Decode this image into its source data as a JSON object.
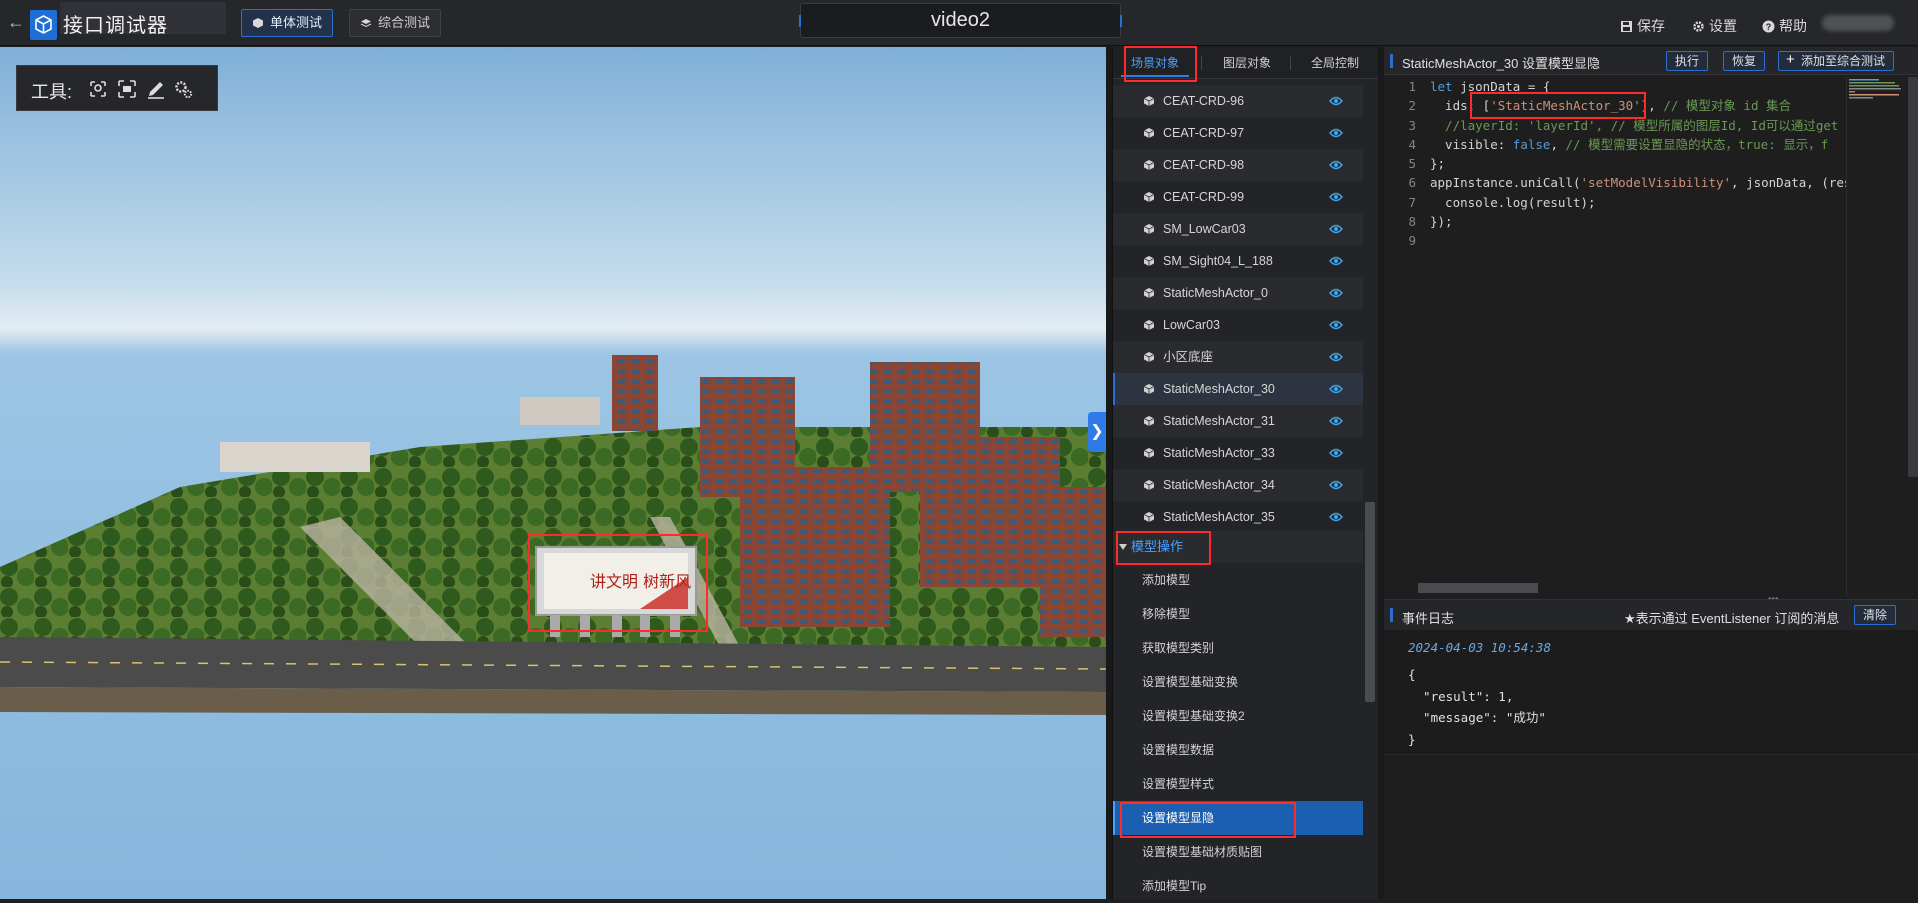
{
  "app": {
    "title": "接口调试器",
    "video_title": "video2"
  },
  "tabs": {
    "single": "单体测试",
    "combined": "综合测试"
  },
  "top_actions": {
    "save": "保存",
    "settings": "设置",
    "help": "帮助"
  },
  "tools": {
    "label": "工具:",
    "icons": [
      "location-pick-icon",
      "frame-select-icon",
      "draw-pen-icon",
      "settings-gears-icon"
    ]
  },
  "mid_tabs": [
    "场景对象",
    "图层对象",
    "全局控制"
  ],
  "objects": [
    "CEAT-CRD-96",
    "CEAT-CRD-97",
    "CEAT-CRD-98",
    "CEAT-CRD-99",
    "SM_LowCar03",
    "SM_Sight04_L_188",
    "StaticMeshActor_0",
    "LowCar03",
    "小区底座",
    "StaticMeshActor_30",
    "StaticMeshActor_31",
    "StaticMeshActor_33",
    "StaticMeshActor_34",
    "StaticMeshActor_35"
  ],
  "group": {
    "label": "模型操作",
    "items": [
      "添加模型",
      "移除模型",
      "获取模型类别",
      "设置模型基础变换",
      "设置模型基础变换2",
      "设置模型数据",
      "设置模型样式",
      "设置模型显隐",
      "设置模型基础材质贴图",
      "添加模型Tip"
    ]
  },
  "code": {
    "title": "StaticMeshActor_30 设置模型显隐",
    "buttons": {
      "run": "执行",
      "restore": "恢复",
      "add": "添加至综合测试"
    },
    "lines": [
      [
        [
          "kw",
          "let "
        ],
        [
          "txt",
          "jsonData = {"
        ]
      ],
      [
        [
          "txt",
          "  ids: ["
        ],
        [
          "str",
          "'StaticMeshActor_30'"
        ],
        [
          "txt",
          "], "
        ],
        [
          "cm",
          "// 模型对象 id 集合"
        ]
      ],
      [
        [
          "cm",
          "  //layerId: 'layerId', // 模型所属的图层Id, Id可以通过get"
        ]
      ],
      [
        [
          "txt",
          "  visible: "
        ],
        [
          "kw",
          "false"
        ],
        [
          "txt",
          ", "
        ],
        [
          "cm",
          "// 模型需要设置显隐的状态，true: 显示，f"
        ]
      ],
      [
        [
          "txt",
          "};"
        ]
      ],
      [
        [
          "txt",
          "appInstance.uniCall("
        ],
        [
          "str",
          "'setModelVisibility'"
        ],
        [
          "txt",
          ", jsonData, (res"
        ]
      ],
      [
        [
          "txt",
          "  console.log(result);"
        ]
      ],
      [
        [
          "txt",
          "});"
        ]
      ],
      [
        [
          "txt",
          ""
        ]
      ]
    ]
  },
  "log": {
    "title": "事件日志",
    "note": "★表示通过 EventListener 订阅的消息",
    "clear": "清除",
    "time": "2024-04-03 10:54:38",
    "json": "{\n  \"result\": 1,\n  \"message\": \"成功\"\n}"
  },
  "colors": {
    "accent": "#2b6fd0",
    "highlight": "#ff2a2a",
    "active_item": "#1b5fb1"
  },
  "billboard_text": "讲文明 树新风"
}
